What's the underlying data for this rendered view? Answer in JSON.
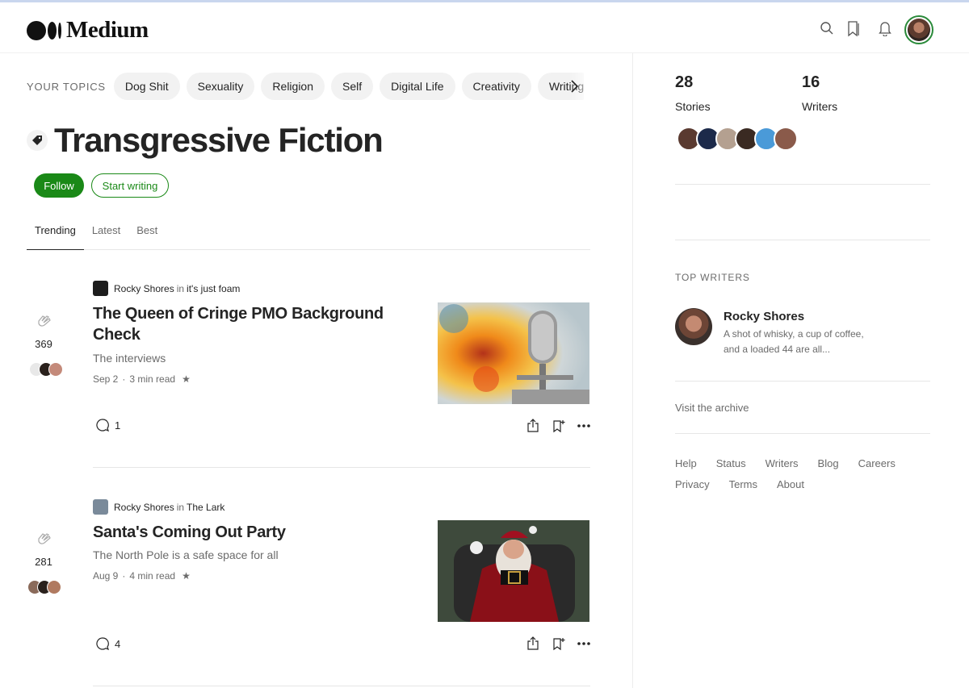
{
  "app": {
    "logo_text": "Medium"
  },
  "header": {
    "icons": [
      "search-icon",
      "bookmarks-icon",
      "notifications-icon"
    ]
  },
  "topics": {
    "label": "YOUR TOPICS",
    "items": [
      "Dog Shit",
      "Sexuality",
      "Religion",
      "Self",
      "Digital Life",
      "Creativity",
      "Writing"
    ]
  },
  "tag": {
    "title": "Transgressive Fiction",
    "follow_label": "Follow",
    "start_writing_label": "Start writing"
  },
  "tabs": [
    "Trending",
    "Latest",
    "Best"
  ],
  "articles": [
    {
      "author": "Rocky Shores",
      "in_word": "in",
      "publication": "it's just foam",
      "title": "The Queen of Cringe PMO Background Check",
      "subtitle": "The interviews",
      "date": "Sep 2",
      "dot": "·",
      "read_time": "3 min read",
      "claps": "369",
      "responses": "1"
    },
    {
      "author": "Rocky Shores",
      "in_word": "in",
      "publication": "The Lark",
      "title": "Santa's Coming Out Party",
      "subtitle": "The North Pole is a safe space for all",
      "date": "Aug 9",
      "dot": "·",
      "read_time": "4 min read",
      "claps": "281",
      "responses": "4"
    }
  ],
  "sidebar": {
    "stories_count": "28",
    "stories_label": "Stories",
    "writers_count": "16",
    "writers_label": "Writers",
    "top_writers_label": "TOP WRITERS",
    "top_writer": {
      "name": "Rocky Shores",
      "bio": "A shot of whisky, a cup of coffee, and a loaded 44 are all..."
    },
    "archive_link": "Visit the archive",
    "footer_links": [
      "Help",
      "Status",
      "Writers",
      "Blog",
      "Careers",
      "Privacy",
      "Terms",
      "About"
    ]
  },
  "colors": {
    "accent_green": "#1a8917",
    "text": "#242424",
    "muted": "#6b6b6b"
  }
}
